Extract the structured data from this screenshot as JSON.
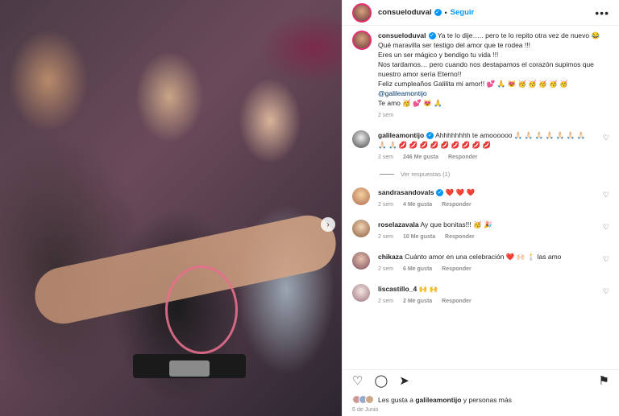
{
  "post": {
    "author": "consueloduval",
    "follow_label": "Seguir",
    "dot": "•",
    "more_label": "•••",
    "next_label": "›"
  },
  "caption": {
    "author": "consueloduval",
    "lines": [
      "Ya te lo dije….. pero te lo repito otra vez de nuevo 😂",
      "Qué maravilla ser testigo del amor que te rodea !!!",
      "Eres un ser mágico y bendigo tu vida !!!",
      "Nos tardamos… pero cuando nos destapamos el corazón supimos que nuestro amor sería Eterno!!",
      "Feliz cumpleaños Galilita mi amor!! 💕 🙏 😻 🥳 🥳 🥳 🥳 🥳"
    ],
    "mention": "@galileamontijo",
    "last_line": "Te amo 🥳 💕 😻 🙏",
    "time": "2 sem"
  },
  "comments": [
    {
      "user": "galileamontijo",
      "verified": true,
      "text": "Ahhhhhhhh te amoooooo 🙏🏻 🙏🏻 🙏🏻 🙏🏻 🙏🏻 🙏🏻 🙏🏻 🙏🏻 🙏🏻 💋 💋 💋 💋 💋 💋 💋 💋 💋",
      "time": "2 sem",
      "likes": "246 Me gusta",
      "reply": "Responder",
      "view_replies": "Ver respuestas (1)"
    },
    {
      "user": "sandrasandovals",
      "verified": true,
      "text": "❤️ ❤️ ❤️",
      "time": "2 sem",
      "likes": "4 Me gusta",
      "reply": "Responder"
    },
    {
      "user": "roselazavala",
      "verified": false,
      "text": "Ay que bonitas!!! 🥳 🎉",
      "time": "2 sem",
      "likes": "10 Me gusta",
      "reply": "Responder"
    },
    {
      "user": "chikaza",
      "verified": false,
      "text": "Cuánto amor en una celebración ❤️ 🙌🏻 🕯️ las amo",
      "time": "2 sem",
      "likes": "6 Me gusta",
      "reply": "Responder"
    },
    {
      "user": "liscastillo_4",
      "verified": false,
      "text": "🙌 🙌",
      "time": "2 sem",
      "likes": "2 Me gusta",
      "reply": "Responder"
    }
  ],
  "likes_summary": {
    "prefix": "Les gusta a",
    "user": "galileamontijo",
    "suffix": "y personas más"
  },
  "date": "6 de Junio",
  "icons": {
    "heart": "♡",
    "comment": "◯",
    "share": "➤",
    "save": "⚑"
  }
}
